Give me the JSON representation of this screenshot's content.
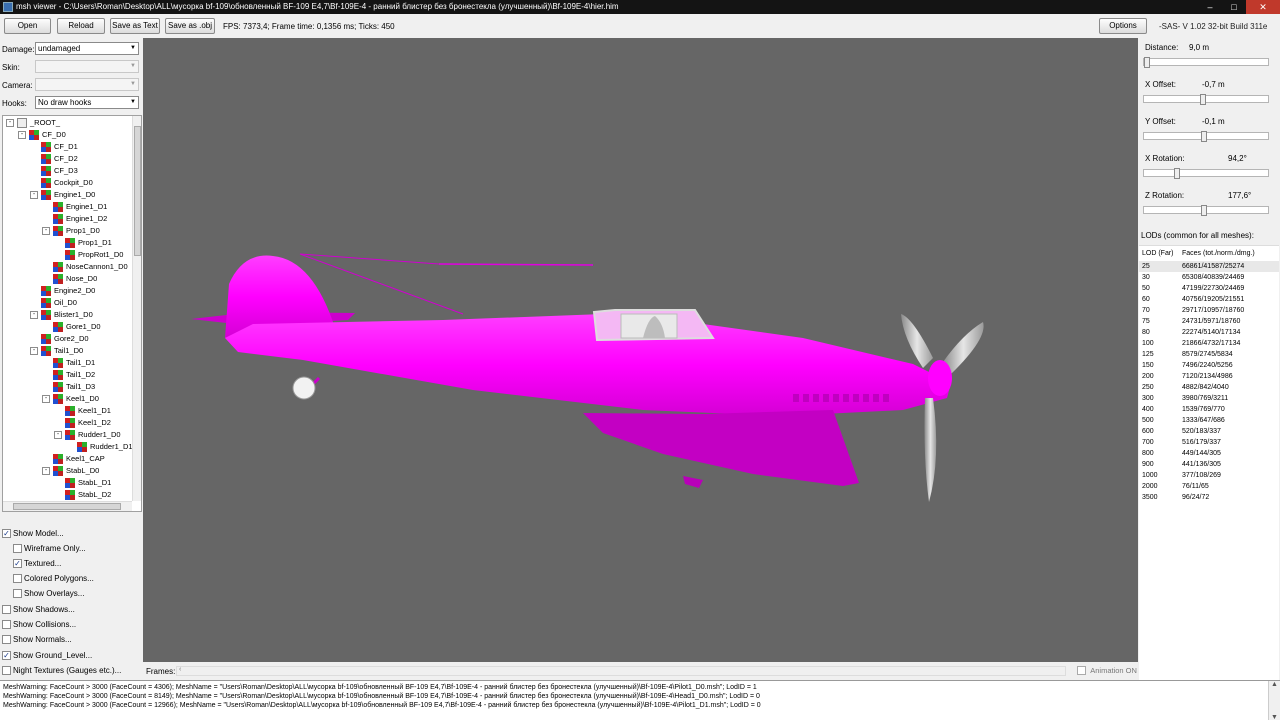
{
  "window": {
    "title": "msh viewer - C:\\Users\\Roman\\Desktop\\ALL\\мусорка bf-109\\обновленный BF-109 E4,7\\Bf-109E-4 - ранний блистер без бронестекла (улучшенный)\\Bf-109E-4\\hier.him"
  },
  "toolbar": {
    "open": "Open",
    "reload": "Reload",
    "save_text": "Save as Text",
    "save_obj": "Save as .obj",
    "fps": "FPS: 7373,4; Frame time: 0,1356 ms; Ticks: 450",
    "options": "Options",
    "version": "-SAS- V 1.02  32-bit  Build 311e"
  },
  "left": {
    "damage_label": "Damage:",
    "damage_value": "undamaged",
    "skin_label": "Skin:",
    "skin_value": "",
    "camera_label": "Camera:",
    "camera_value": "",
    "hooks_label": "Hooks:",
    "hooks_value": "No draw hooks"
  },
  "tree": [
    {
      "label": "_ROOT_",
      "depth": 0,
      "exp": "-",
      "root": true
    },
    {
      "label": "CF_D0",
      "depth": 1,
      "exp": "-"
    },
    {
      "label": "CF_D1",
      "depth": 2,
      "exp": ""
    },
    {
      "label": "CF_D2",
      "depth": 2,
      "exp": ""
    },
    {
      "label": "CF_D3",
      "depth": 2,
      "exp": ""
    },
    {
      "label": "Cockpit_D0",
      "depth": 2,
      "exp": ""
    },
    {
      "label": "Engine1_D0",
      "depth": 2,
      "exp": "-"
    },
    {
      "label": "Engine1_D1",
      "depth": 3,
      "exp": ""
    },
    {
      "label": "Engine1_D2",
      "depth": 3,
      "exp": ""
    },
    {
      "label": "Prop1_D0",
      "depth": 3,
      "exp": "-"
    },
    {
      "label": "Prop1_D1",
      "depth": 4,
      "exp": ""
    },
    {
      "label": "PropRot1_D0",
      "depth": 4,
      "exp": ""
    },
    {
      "label": "NoseCannon1_D0",
      "depth": 3,
      "exp": ""
    },
    {
      "label": "Nose_D0",
      "depth": 3,
      "exp": ""
    },
    {
      "label": "Engine2_D0",
      "depth": 2,
      "exp": ""
    },
    {
      "label": "Oil_D0",
      "depth": 2,
      "exp": ""
    },
    {
      "label": "Blister1_D0",
      "depth": 2,
      "exp": "-"
    },
    {
      "label": "Gore1_D0",
      "depth": 3,
      "exp": ""
    },
    {
      "label": "Gore2_D0",
      "depth": 2,
      "exp": ""
    },
    {
      "label": "Tail1_D0",
      "depth": 2,
      "exp": "-"
    },
    {
      "label": "Tail1_D1",
      "depth": 3,
      "exp": ""
    },
    {
      "label": "Tail1_D2",
      "depth": 3,
      "exp": ""
    },
    {
      "label": "Tail1_D3",
      "depth": 3,
      "exp": ""
    },
    {
      "label": "Keel1_D0",
      "depth": 3,
      "exp": "-"
    },
    {
      "label": "Keel1_D1",
      "depth": 4,
      "exp": ""
    },
    {
      "label": "Keel1_D2",
      "depth": 4,
      "exp": ""
    },
    {
      "label": "Rudder1_D0",
      "depth": 4,
      "exp": "-"
    },
    {
      "label": "Rudder1_D1",
      "depth": 5,
      "exp": ""
    },
    {
      "label": "Keel1_CAP",
      "depth": 3,
      "exp": ""
    },
    {
      "label": "StabL_D0",
      "depth": 3,
      "exp": "-"
    },
    {
      "label": "StabL_D1",
      "depth": 4,
      "exp": ""
    },
    {
      "label": "StabL_D2",
      "depth": 4,
      "exp": ""
    },
    {
      "label": "VatorL_D0",
      "depth": 4,
      "exp": "-"
    }
  ],
  "checks": [
    {
      "label": "Show Model...",
      "checked": true,
      "indent": 0
    },
    {
      "label": "Wireframe Only...",
      "checked": false,
      "indent": 1
    },
    {
      "label": "Textured...",
      "checked": true,
      "indent": 1
    },
    {
      "label": "Colored Polygons...",
      "checked": false,
      "indent": 1
    },
    {
      "label": "Show Overlays...",
      "checked": false,
      "indent": 1
    },
    {
      "label": "Show Shadows...",
      "checked": false,
      "indent": 0
    },
    {
      "label": "Show Collisions...",
      "checked": false,
      "indent": 0
    },
    {
      "label": "Show Normals...",
      "checked": false,
      "indent": 0
    },
    {
      "label": "Show Ground_Level...",
      "checked": true,
      "indent": 0
    },
    {
      "label": "Night Textures (Gauges etc.)...",
      "checked": false,
      "indent": 0
    }
  ],
  "frames": {
    "label": "Frames:",
    "animation_label": "Animation ON",
    "animation_on": false
  },
  "right": {
    "distance_label": "Distance:",
    "distance_value": "9,0 m",
    "distance_pos": 0.0,
    "xoff_label": "X Offset:",
    "xoff_value": "-0,7 m",
    "xoff_pos": 0.48,
    "yoff_label": "Y Offset:",
    "yoff_value": "-0,1 m",
    "yoff_pos": 0.49,
    "xrot_label": "X Rotation:",
    "xrot_value": "94,2°",
    "xrot_pos": 0.26,
    "zrot_label": "Z Rotation:",
    "zrot_value": "177,6°",
    "zrot_pos": 0.49,
    "lods_title": "LODs (common for all meshes):",
    "lod_col": "LOD (Far)",
    "faces_col": "Faces (tot./norm./dmg.)"
  },
  "lods": [
    [
      "25",
      "66861/41587/25274"
    ],
    [
      "30",
      "65308/40839/24469"
    ],
    [
      "50",
      "47199/22730/24469"
    ],
    [
      "60",
      "40756/19205/21551"
    ],
    [
      "70",
      "29717/10957/18760"
    ],
    [
      "75",
      "24731/5971/18760"
    ],
    [
      "80",
      "22274/5140/17134"
    ],
    [
      "100",
      "21866/4732/17134"
    ],
    [
      "125",
      "8579/2745/5834"
    ],
    [
      "150",
      "7496/2240/5256"
    ],
    [
      "200",
      "7120/2134/4986"
    ],
    [
      "250",
      "4882/842/4040"
    ],
    [
      "300",
      "3980/769/3211"
    ],
    [
      "400",
      "1539/769/770"
    ],
    [
      "500",
      "1333/647/686"
    ],
    [
      "600",
      "520/183/337"
    ],
    [
      "700",
      "516/179/337"
    ],
    [
      "800",
      "449/144/305"
    ],
    [
      "900",
      "441/136/305"
    ],
    [
      "1000",
      "377/108/269"
    ],
    [
      "2000",
      "76/11/65"
    ],
    [
      "3500",
      "96/24/72"
    ]
  ],
  "log": [
    "MeshWarning: FaceCount > 3000 (FaceCount = 4306); MeshName = \"Users\\Roman\\Desktop\\ALL\\мусорка bf-109\\обновленный BF-109 E4,7\\Bf-109E-4 - ранний блистер без бронестекла (улучшенный)\\Bf-109E-4\\Pilot1_D0.msh\"; LodID = 1",
    "MeshWarning: FaceCount > 3000 (FaceCount = 8149); MeshName = \"Users\\Roman\\Desktop\\ALL\\мусорка bf-109\\обновленный BF-109 E4,7\\Bf-109E-4 - ранний блистер без бронестекла (улучшенный)\\Bf-109E-4\\Head1_D0.msh\"; LodID = 0",
    "MeshWarning: FaceCount > 3000 (FaceCount = 12966); MeshName = \"Users\\Roman\\Desktop\\ALL\\мусорка bf-109\\обновленный BF-109 E4,7\\Bf-109E-4 - ранний блистер без бронестекла (улучшенный)\\Bf-109E-4\\Pilot1_D1.msh\"; LodID = 0"
  ],
  "colors": {
    "viewport_bg": "#666666",
    "model": "#ff00ff",
    "prop": "#c8c8c8"
  }
}
